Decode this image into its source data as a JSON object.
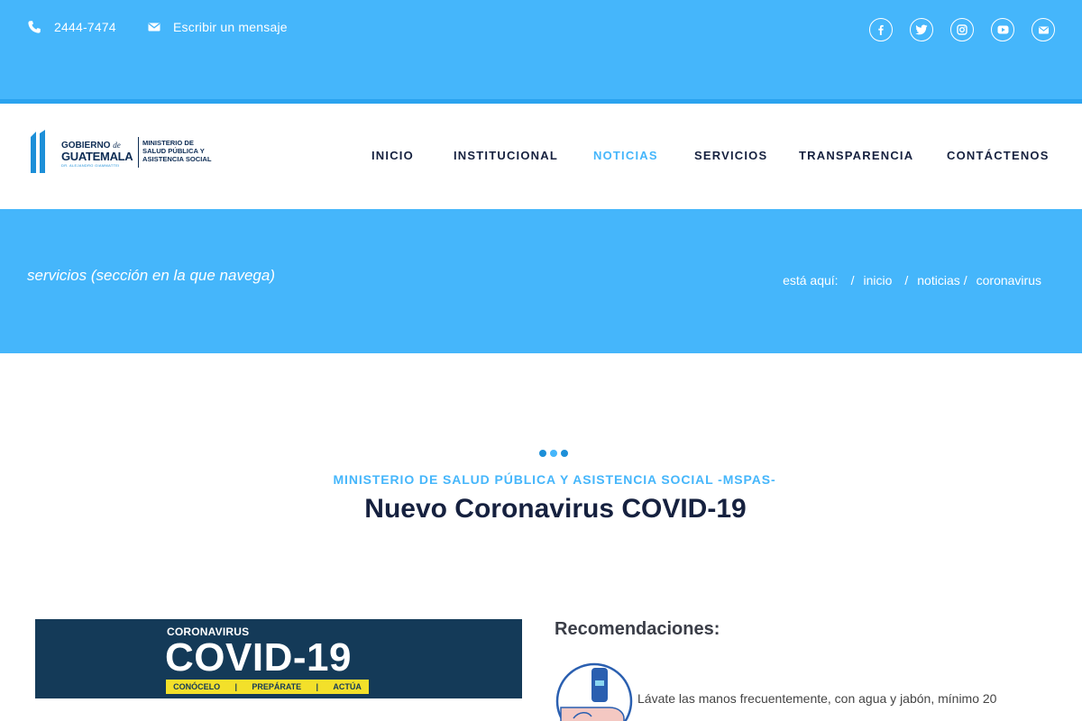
{
  "topbar": {
    "phone": "2444-7474",
    "message": "Escribir un mensaje",
    "social": [
      "facebook-icon",
      "twitter-icon",
      "instagram-icon",
      "youtube-icon",
      "email-icon"
    ],
    "color": "#45b6fb"
  },
  "logo": {
    "gobierno": "GOBIERNO",
    "de": "de",
    "guatemala": "GUATEMALA",
    "subtitle": "DR. ALEJANDRO GIAMMATTEI",
    "ministry_line1": "MINISTERIO DE",
    "ministry_line2": "SALUD PÚBLICA Y",
    "ministry_line3": "ASISTENCIA SOCIAL"
  },
  "nav": {
    "items": [
      {
        "label": "INICIO"
      },
      {
        "label": "INSTITUCIONAL"
      },
      {
        "label": "NOTICIAS",
        "active": true
      },
      {
        "label": "SERVICIOS"
      },
      {
        "label": "TRANSPARENCIA"
      },
      {
        "label": "CONTÁCTENOS"
      }
    ],
    "active_color": "#45b6fb"
  },
  "banner": {
    "title": "servicios (sección en la que navega)",
    "crumbs_label": "está aquí:",
    "crumbs": [
      "inicio",
      "noticias",
      "coronavirus"
    ]
  },
  "main": {
    "kicker": "MINISTERIO DE SALUD PÚBLICA Y ASISTENCIA SOCIAL -MSPAS-",
    "headline": "Nuevo Coronavirus COVID-19",
    "covid_banner": {
      "top": "CORONAVIRUS",
      "main": "COVID-19",
      "items": [
        "CONÓCELO",
        "PREPÁRATE",
        "ACTÚA"
      ]
    },
    "recommendations_title": "Recomendaciones:",
    "recommendation_1": "Lávate las manos frecuentemente, con agua y jabón, mínimo 20"
  }
}
